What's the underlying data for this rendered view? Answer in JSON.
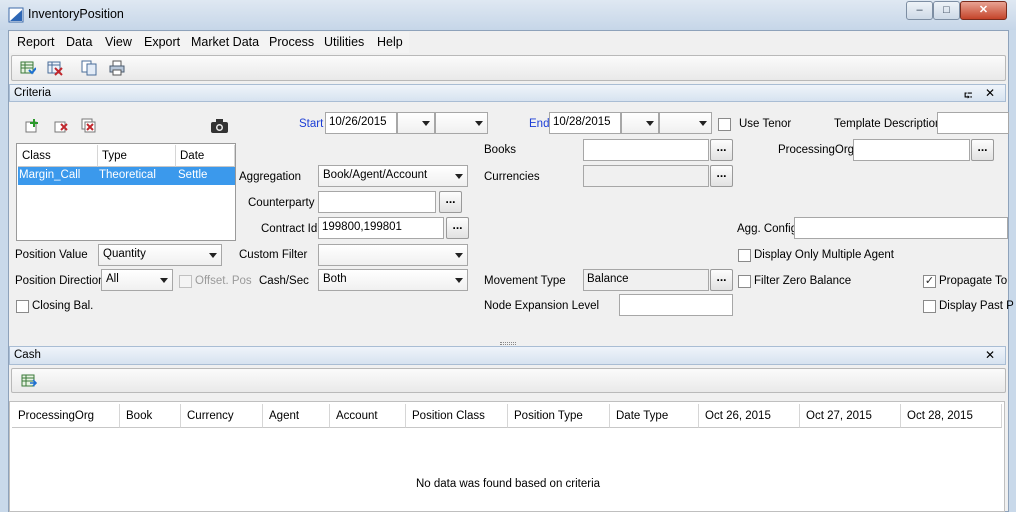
{
  "window": {
    "title": "InventoryPosition",
    "min": "–",
    "max": "□",
    "close": "✕"
  },
  "menu": [
    "Report",
    "Data",
    "View",
    "Export",
    "Market Data",
    "Process",
    "Utilities",
    "Help"
  ],
  "criteria": {
    "header": "Criteria",
    "pin": "⮓",
    "close": "✕",
    "class_table": {
      "columns": [
        "Class",
        "Type",
        "Date"
      ],
      "rows": [
        {
          "class": "Margin_Call",
          "type": "Theoretical",
          "date": "Settle"
        }
      ]
    },
    "start_label": "Start",
    "start_value": "10/26/2015",
    "end_label": "End",
    "end_value": "10/28/2015",
    "use_tenor": "Use Tenor",
    "template_description": "Template Description",
    "aggregation_label": "Aggregation",
    "aggregation_value": "Book/Agent/Account",
    "counterparty_label": "Counterparty",
    "contract_id_label": "Contract Id",
    "contract_id_value": "199800,199801",
    "custom_filter_label": "Custom Filter",
    "position_value_label": "Position Value",
    "position_value_value": "Quantity",
    "position_direction_label": "Position Direction",
    "position_direction_value": "All",
    "offset_pos": "Offset. Pos",
    "cash_sec_label": "Cash/Sec",
    "cash_sec_value": "Both",
    "closing_bal": "Closing Bal.",
    "books_label": "Books",
    "currencies_label": "Currencies",
    "processing_org_label": "ProcessingOrg",
    "agg_config_label": "Agg. Config",
    "display_only_multiple_agent": "Display Only Multiple Agent",
    "movement_type_label": "Movement Type",
    "movement_type_value": "Balance",
    "filter_zero_balance": "Filter Zero Balance",
    "propagate_to": "Propagate To",
    "node_expansion_level": "Node Expansion Level",
    "display_past": "Display Past P",
    "dots": "...",
    "checked_mark": "✓"
  },
  "cash": {
    "header": "Cash",
    "close": "✕",
    "columns": [
      "ProcessingOrg",
      "Book",
      "Currency",
      "Agent",
      "Account",
      "Position Class",
      "Position Type",
      "Date Type",
      "Oct 26, 2015",
      "Oct 27, 2015",
      "Oct 28, 2015"
    ],
    "empty_message": "No data was found based on criteria"
  },
  "colors": {
    "accent": "#1c3ed6",
    "selection": "#3b99ec"
  }
}
